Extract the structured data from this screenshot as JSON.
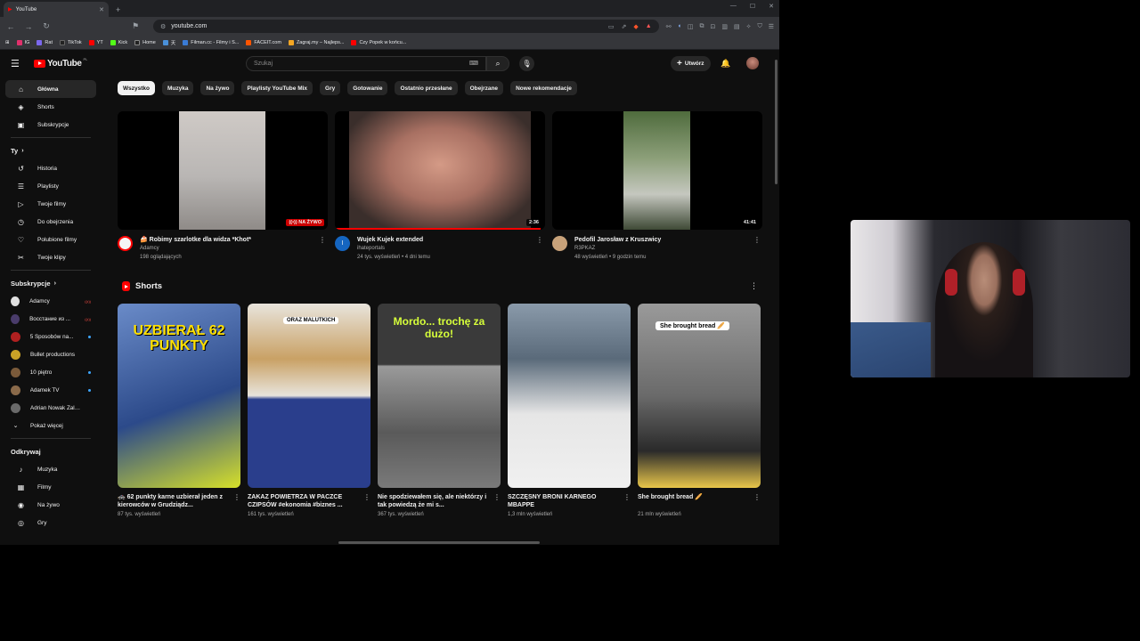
{
  "browser": {
    "tab_title": "YouTube",
    "url": "youtube.com",
    "bookmarks": [
      "IG",
      "Rat",
      "TikTok",
      "YT",
      "Kick",
      "Home",
      "天",
      "Filman.cc - Filmy i S...",
      "FACEIT.com",
      "Zagraj.my – Najleps...",
      "Czy Popek w końcu..."
    ],
    "bookmark_colors": [
      "#e1306c",
      "#7b68ee",
      "#000000",
      "#ff0000",
      "#53fc18",
      "#000000",
      "#4a90d9",
      "#3a7bd5",
      "#ff5500",
      "#f5a623",
      "#ff0000"
    ]
  },
  "header": {
    "logo_text": "YouTube",
    "country": "PL",
    "search_placeholder": "Szukaj",
    "create_label": "Utwórz"
  },
  "sidebar": {
    "main": [
      {
        "label": "Główna",
        "icon": "home-icon",
        "glyph": "⌂"
      },
      {
        "label": "Shorts",
        "icon": "shorts-icon",
        "glyph": "◈"
      },
      {
        "label": "Subskrypcje",
        "icon": "subscriptions-icon",
        "glyph": "▣"
      }
    ],
    "you_title": "Ty",
    "you": [
      {
        "label": "Historia",
        "icon": "history-icon",
        "glyph": "↺"
      },
      {
        "label": "Playlisty",
        "icon": "playlists-icon",
        "glyph": "☰"
      },
      {
        "label": "Twoje filmy",
        "icon": "your-videos-icon",
        "glyph": "▷"
      },
      {
        "label": "Do obejrzenia",
        "icon": "watch-later-icon",
        "glyph": "◷"
      },
      {
        "label": "Polubione filmy",
        "icon": "liked-icon",
        "glyph": "👍"
      },
      {
        "label": "Twoje klipy",
        "icon": "clips-icon",
        "glyph": "✂"
      }
    ],
    "subs_title": "Subskrypcje",
    "subs": [
      {
        "label": "Adamcy",
        "color": "#e0e0e0",
        "status": "live"
      },
      {
        "label": "Восстание из ...",
        "color": "#4a3c6b",
        "status": "live"
      },
      {
        "label": "5 Sposobów na...",
        "color": "#b02020",
        "status": "dot"
      },
      {
        "label": "Bullet productions",
        "color": "#c9a227",
        "status": "none"
      },
      {
        "label": "10 piętro",
        "color": "#7a5a3a",
        "status": "dot"
      },
      {
        "label": "Adamek TV",
        "color": "#8a6a4a",
        "status": "dot"
      },
      {
        "label": "Adrian Nowak Zalno",
        "color": "#6a6a6a",
        "status": "none"
      }
    ],
    "show_more": "Pokaż więcej",
    "explore_title": "Odkrywaj",
    "explore": [
      {
        "label": "Muzyka",
        "icon": "music-icon",
        "glyph": "♪"
      },
      {
        "label": "Filmy",
        "icon": "movies-icon",
        "glyph": "▦"
      },
      {
        "label": "Na żywo",
        "icon": "live-icon",
        "glyph": "◉"
      },
      {
        "label": "Gry",
        "icon": "gaming-icon",
        "glyph": "◎"
      }
    ],
    "live_tag": "((•))"
  },
  "chips": [
    "Wszystko",
    "Muzyka",
    "Na żywo",
    "Playlisty YouTube Mix",
    "Gry",
    "Gotowanie",
    "Ostatnio przesłane",
    "Obejrzane",
    "Nowe rekomendacje"
  ],
  "videos": [
    {
      "title": "🍰 Robimy szarlotke dla widza *Khot*",
      "channel": "Adamcy",
      "stats": "198 oglądających",
      "badge": "((•)) NA ŻYWO",
      "badge_type": "live",
      "avatar_color": "#f5f5f5",
      "thumb_color": "#b9b6b4"
    },
    {
      "title": "Wujek Kujek extended",
      "channel": "ihateportals",
      "stats": "24 tys. wyświetleń • 4 dni temu",
      "badge": "2:36",
      "badge_type": "time",
      "avatar_color": "#1565c0",
      "avatar_letter": "I",
      "thumb_color": "#8a6a60",
      "watched_fraction": 0.99
    },
    {
      "title": "Pedofil Jarosław z Kruszwicy",
      "channel": "R3PKAZ",
      "stats": "48 wyświetleń • 9 godzin temu",
      "badge": "41:41",
      "badge_type": "time",
      "avatar_color": "#c8a27a",
      "thumb_color": "#5f7a4f"
    }
  ],
  "shorts_title": "Shorts",
  "shorts": [
    {
      "title": "🚓 62 punkty karne uzbierał jeden z kierowców w Grudziądz...",
      "views": "87 tys. wyświetleń",
      "overlay": "UZBIERAŁ 62 PUNKTY",
      "bg": "#2c4a8a"
    },
    {
      "title": "ZAKAZ POWIETRZA W PACZCE CZIPSÓW #ekonomia #biznes ...",
      "views": "161 tys. wyświetleń",
      "overlay": "ORAZ MALUTKICH",
      "bg": "#2a3e8c"
    },
    {
      "title": "Nie spodziewałem się, ale niektórzy i tak powiedzą że mi s...",
      "views": "367 tys. wyświetleń",
      "overlay": "Mordo... trochę za dużo!",
      "bg": "#3a3a3a"
    },
    {
      "title": "SZCZĘSNY BRONI KARNEGO MBAPPE",
      "views": "1,3 mln wyświetleń",
      "overlay": "",
      "bg": "#5a6a7a"
    },
    {
      "title": "She brought bread 🥖",
      "views": "21 mln wyświetleń",
      "overlay": "She brought bread 🥖",
      "bg": "#6a6a6a"
    }
  ],
  "colors": {
    "yt_red": "#ff0000",
    "background": "#0f0f0f",
    "chip_bg": "#272727",
    "text_secondary": "#aaaaaa"
  }
}
